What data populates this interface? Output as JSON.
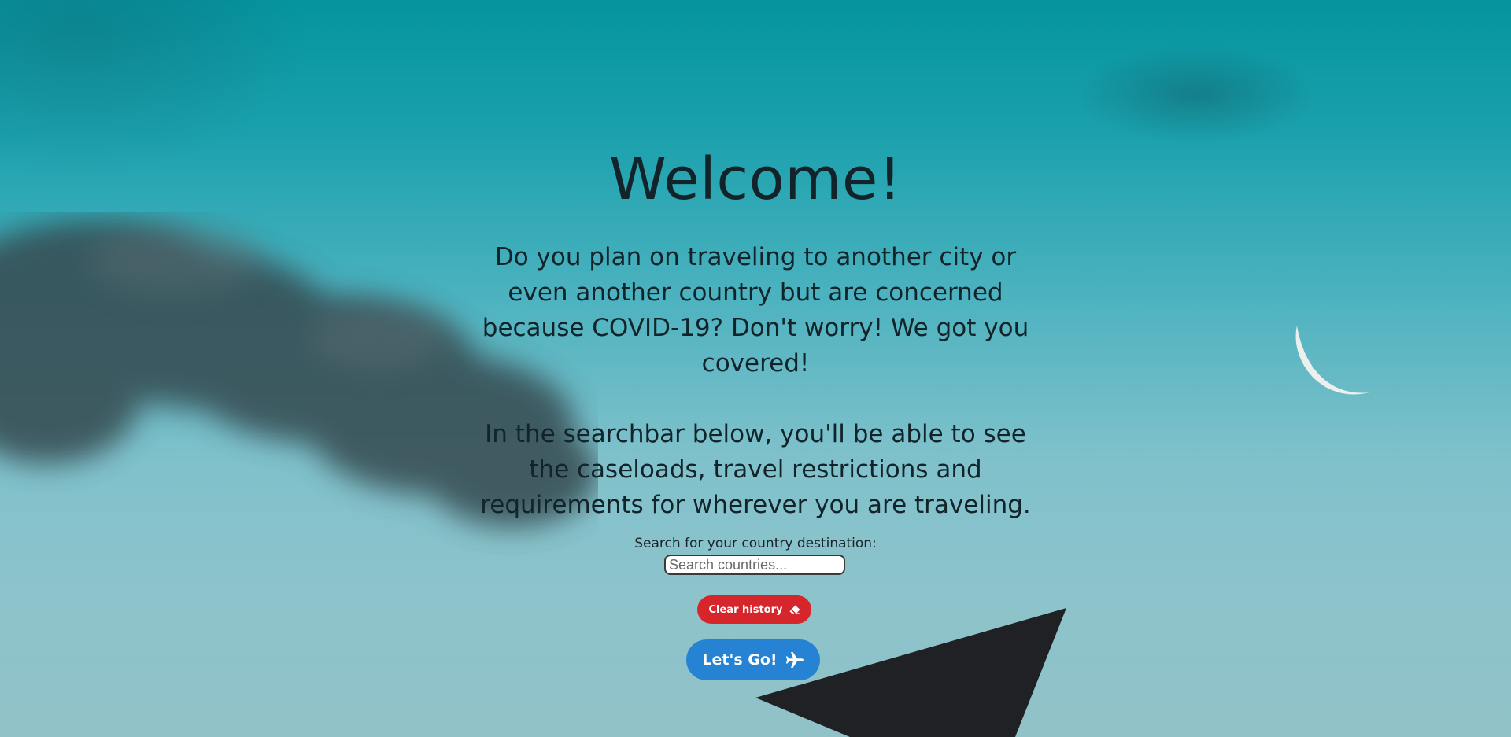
{
  "page": {
    "title": "Welcome!",
    "intro_paragraphs": [
      "Do you plan on traveling to another city or even another country but are concerned because COVID-19? Don't worry! We got you covered!",
      "In the searchbar below, you'll be able to see the caseloads, travel restrictions and requirements for wherever you are traveling."
    ]
  },
  "search": {
    "label": "Search for your country destination:",
    "placeholder": "Search countries...",
    "value": ""
  },
  "buttons": {
    "clear_history": {
      "label": "Clear history",
      "icon": "eraser-icon",
      "color": "#d6262b"
    },
    "lets_go": {
      "label": "Let's Go!",
      "icon": "airplane-icon",
      "color": "#2683d3"
    }
  },
  "background": {
    "description_colors": {
      "sky_top": "#05949f",
      "sky_bottom": "#90c2c8",
      "cloud": "#34494f",
      "moon": "#f2f2ee"
    }
  }
}
